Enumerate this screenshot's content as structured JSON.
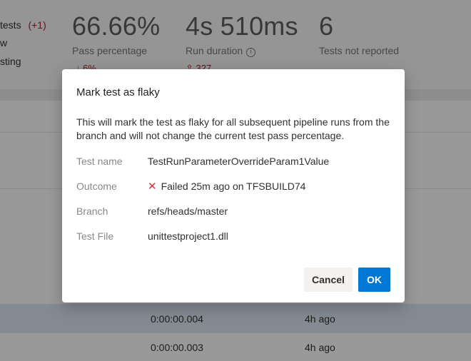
{
  "summary": {
    "left_lines": [
      "tests",
      "w",
      "sting"
    ],
    "tests_delta": "(+1)"
  },
  "metrics": [
    {
      "value": "66.66%",
      "label": "Pass percentage",
      "trend": "6%"
    },
    {
      "value": "4s 510ms",
      "label": "Run duration",
      "trend": "327"
    },
    {
      "value": "6",
      "label": "Tests not reported"
    }
  ],
  "rows": [
    {
      "duration": "0:00:00.004",
      "age": "4h ago"
    },
    {
      "duration": "0:00:00.003",
      "age": "4h ago"
    }
  ],
  "dialog": {
    "title": "Mark test as flaky",
    "description": "This will mark the test as flaky for all subsequent pipeline runs from the branch and will not change the current test pass percentage.",
    "fields": [
      {
        "label": "Test name",
        "value": "TestRunParameterOverrideParam1Value"
      },
      {
        "label": "Outcome",
        "value": "Failed 25m ago on TFSBUILD74",
        "icon": "failed-x-icon"
      },
      {
        "label": "Branch",
        "value": "refs/heads/master"
      },
      {
        "label": "Test File",
        "value": "unittestproject1.dll"
      }
    ],
    "cancel_label": "Cancel",
    "ok_label": "OK"
  },
  "colors": {
    "primary": "#0078d4",
    "fail": "#d13438",
    "delta": "#a4262c"
  }
}
